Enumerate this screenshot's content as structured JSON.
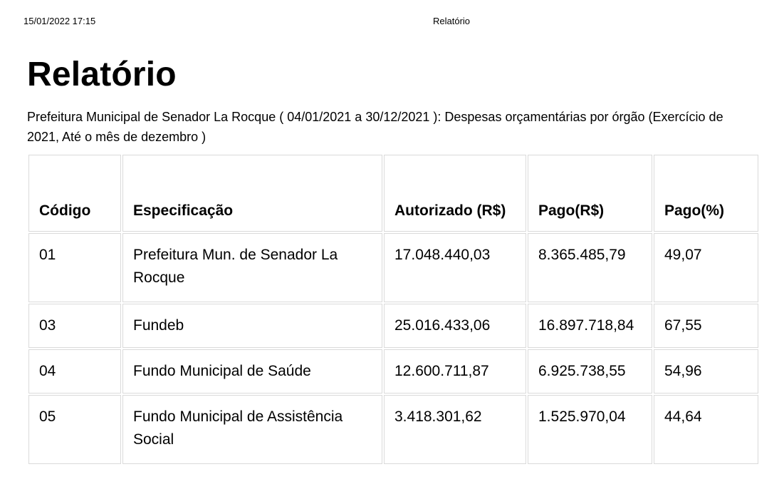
{
  "print_header": {
    "datetime": "15/01/2022 17:15",
    "title": "Relatório"
  },
  "report": {
    "title": "Relatório",
    "subtitle": "Prefeitura Municipal de Senador La Rocque ( 04/01/2021 a 30/12/2021 ): Despesas orçamentárias por órgão (Exercício de 2021, Até o mês de dezembro )"
  },
  "table": {
    "headers": [
      "Código",
      "Especificação",
      "Autorizado (R$)",
      "Pago(R$)",
      "Pago(%)"
    ],
    "rows": [
      [
        "01",
        "Prefeitura Mun. de Senador La Rocque",
        "17.048.440,03",
        "8.365.485,79",
        "49,07"
      ],
      [
        "03",
        "Fundeb",
        "25.016.433,06",
        "16.897.718,84",
        "67,55"
      ],
      [
        "04",
        "Fundo Municipal de Saúde",
        "12.600.711,87",
        "6.925.738,55",
        "54,96"
      ],
      [
        "05",
        "Fundo Municipal de Assistência Social",
        "3.418.301,62",
        "1.525.970,04",
        "44,64"
      ]
    ]
  }
}
